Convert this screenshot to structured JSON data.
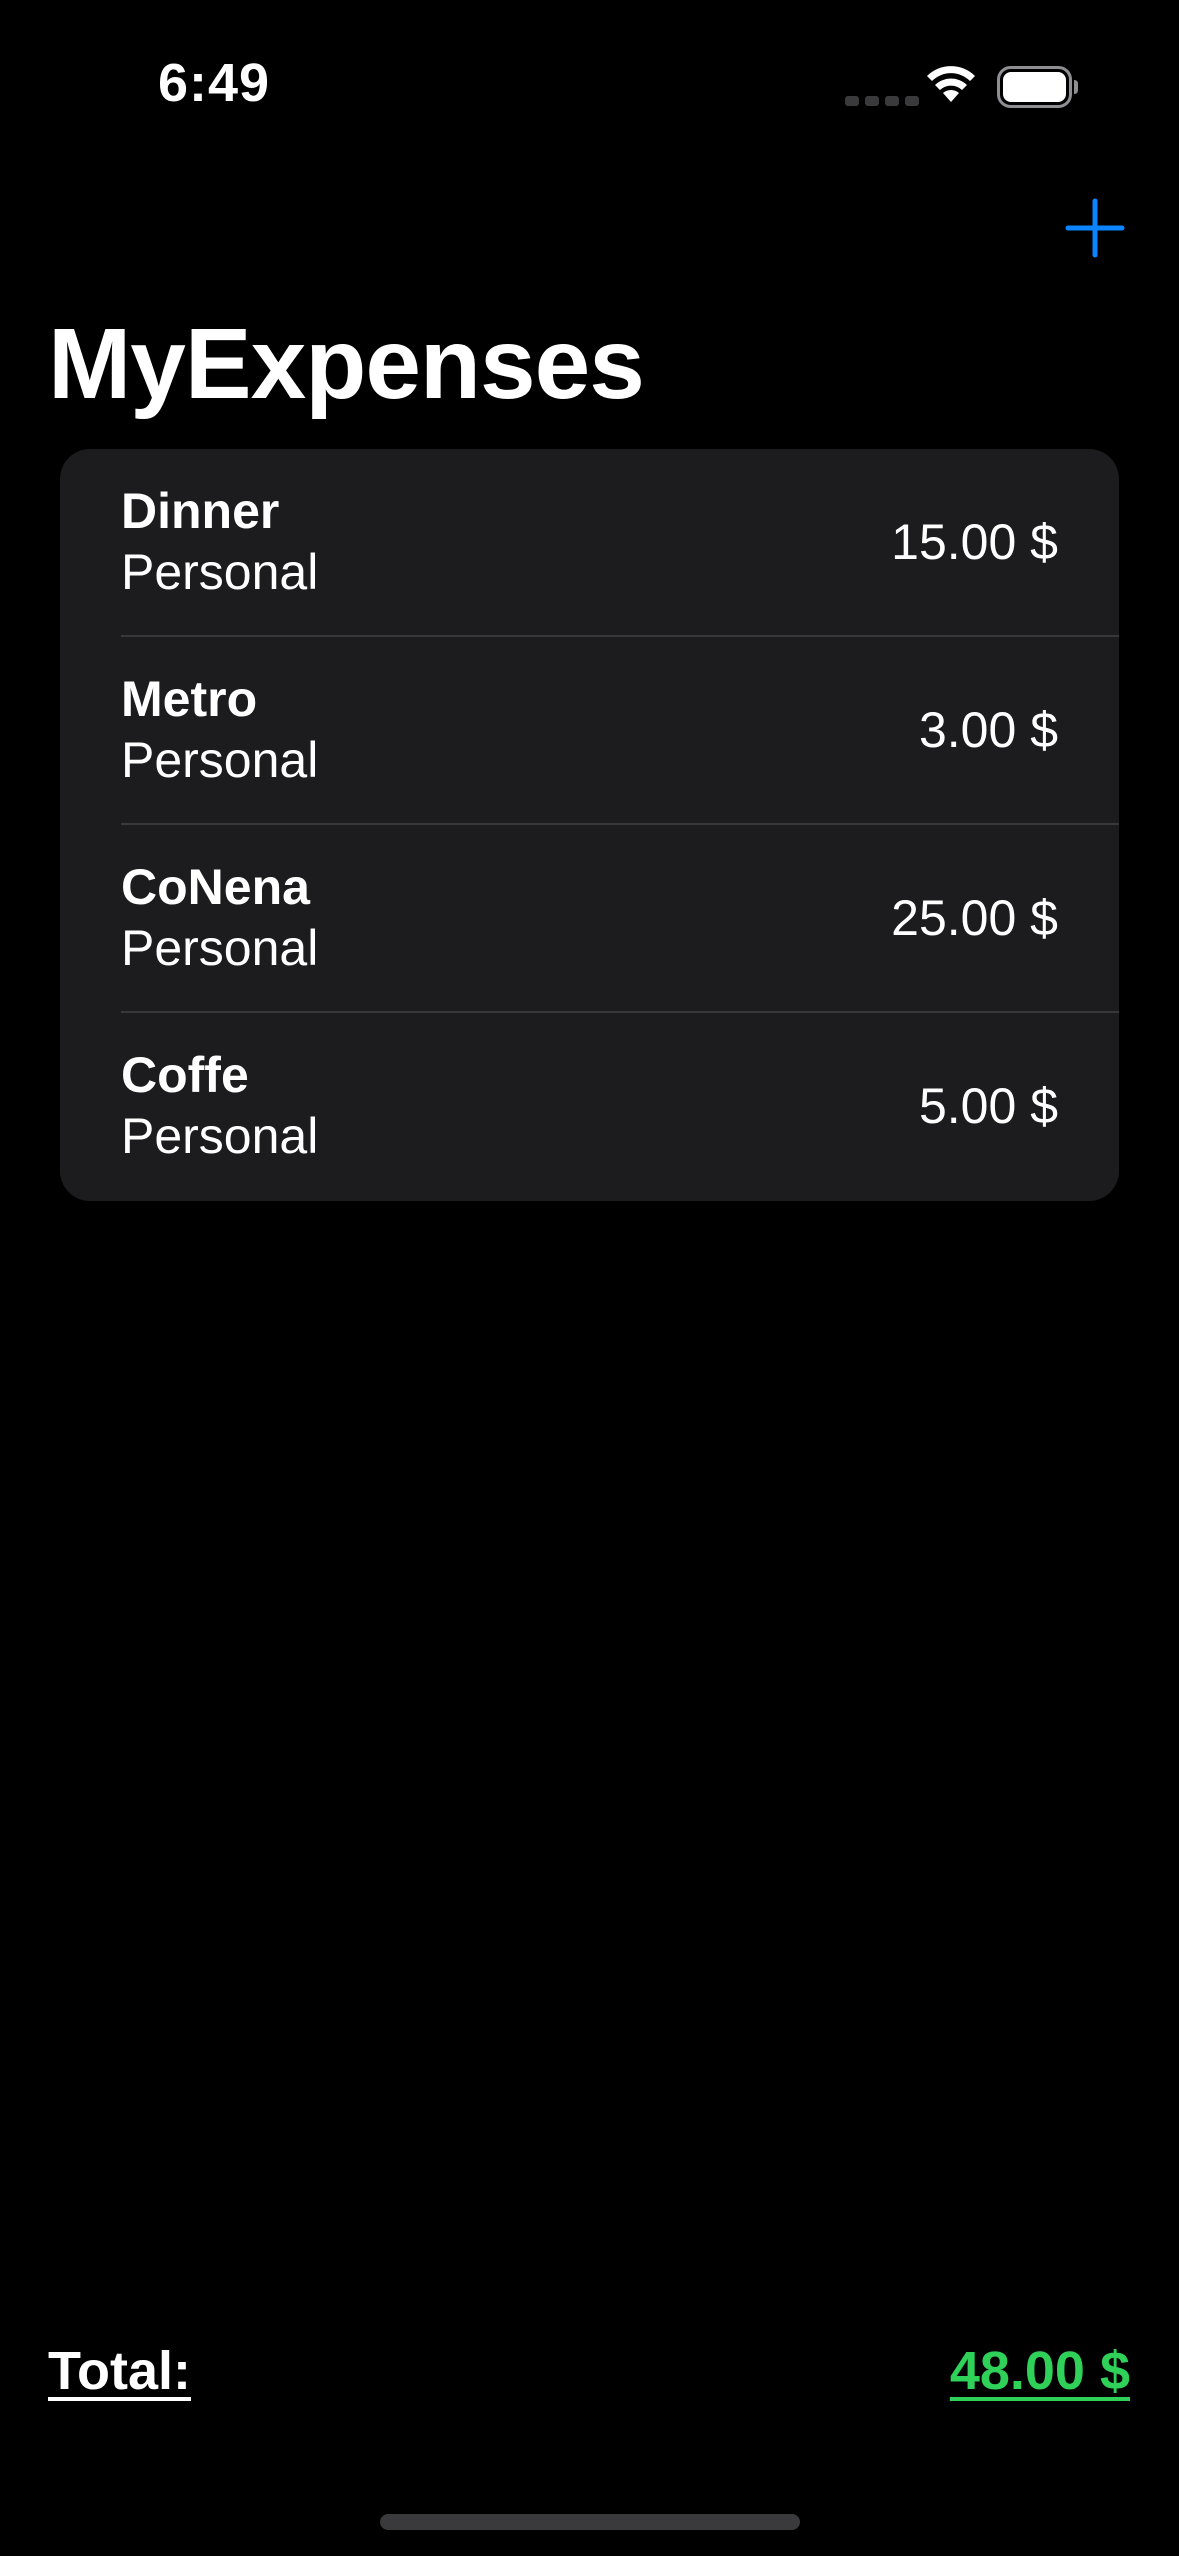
{
  "status_bar": {
    "time": "6:49",
    "icons": [
      "cellular-signal-icon",
      "wifi-icon",
      "battery-icon"
    ]
  },
  "navigation": {
    "title": "MyExpenses",
    "add_icon": "plus-icon"
  },
  "expenses": [
    {
      "name": "Dinner",
      "category": "Personal",
      "amount": "15.00 $"
    },
    {
      "name": "Metro",
      "category": "Personal",
      "amount": "3.00 $"
    },
    {
      "name": "CoNena",
      "category": "Personal",
      "amount": "25.00 $"
    },
    {
      "name": "Coffe",
      "category": "Personal",
      "amount": "5.00 $"
    }
  ],
  "footer": {
    "total_label": "Total:",
    "total_value": "48.00 $"
  },
  "colors": {
    "background": "#000000",
    "card": "#1c1c1e",
    "accent_blue": "#0a84ff",
    "total_green": "#30d158",
    "text": "#ffffff"
  }
}
